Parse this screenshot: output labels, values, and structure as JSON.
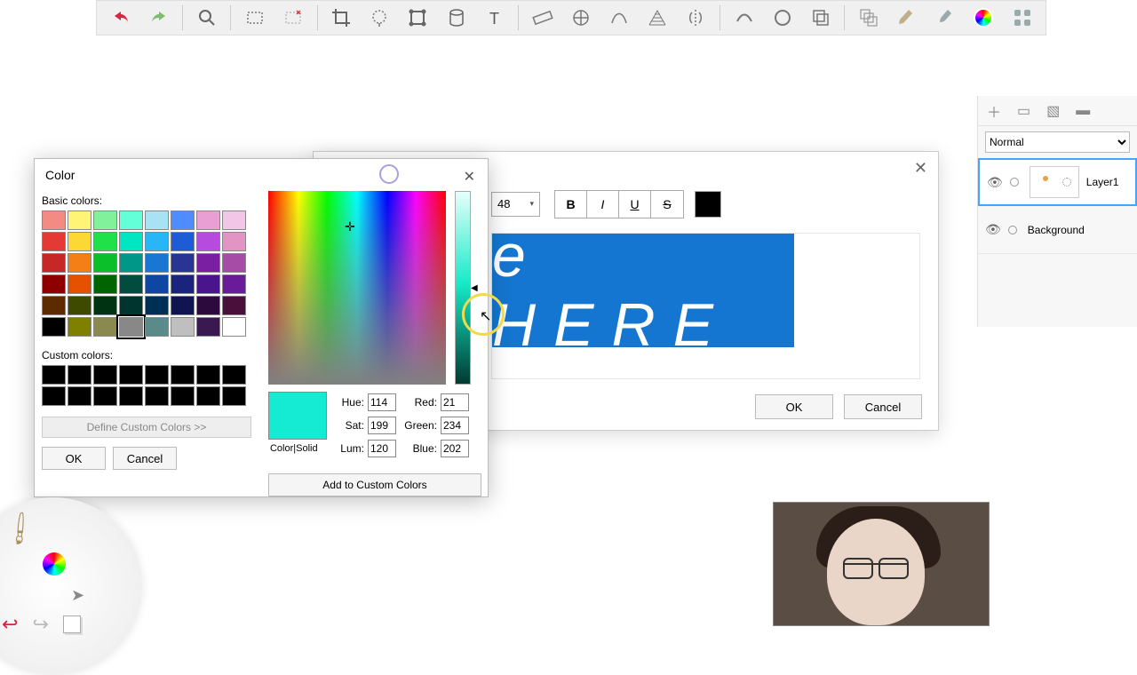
{
  "toolbar_icons": [
    "undo",
    "redo",
    "zoom",
    "select-rect",
    "select-remove",
    "crop",
    "select-free",
    "shape",
    "cylinder",
    "text",
    "ruler",
    "circle-tool",
    "paint",
    "mesh",
    "mirror",
    "curve",
    "ellipse",
    "stack",
    "copies",
    "pencil",
    "brush",
    "color-wheel",
    "grid-icons"
  ],
  "text_dialog": {
    "font_size": "48",
    "bold": "B",
    "italic": "I",
    "underline": "U",
    "strike": "S",
    "banner_text": "e  HERE",
    "ok": "OK",
    "cancel": "Cancel"
  },
  "color_dialog": {
    "title": "Color",
    "basic_label": "Basic colors:",
    "custom_label": "Custom colors:",
    "define": "Define Custom Colors >>",
    "ok": "OK",
    "cancel": "Cancel",
    "preview_label": "Color|Solid",
    "hue_label": "Hue:",
    "sat_label": "Sat:",
    "lum_label": "Lum:",
    "red_label": "Red:",
    "green_label": "Green:",
    "blue_label": "Blue:",
    "hue": "114",
    "sat": "199",
    "lum": "120",
    "red": "21",
    "green": "234",
    "blue": "202",
    "add_custom": "Add to Custom Colors",
    "basic_colors": [
      "#f28b82",
      "#fff475",
      "#81f29b",
      "#62ffd9",
      "#a7e3f2",
      "#4e8cff",
      "#e99fd4",
      "#f2c6e6",
      "#e53935",
      "#fdd835",
      "#1fe24a",
      "#00e6c3",
      "#29b6f6",
      "#1e5bd6",
      "#b74be0",
      "#e295c4",
      "#c62828",
      "#f57f17",
      "#0bbf2a",
      "#009688",
      "#1976d2",
      "#283593",
      "#7b1fa2",
      "#a64ca6",
      "#8e0000",
      "#e65100",
      "#006400",
      "#004d40",
      "#0d47a1",
      "#1a237e",
      "#4a148c",
      "#6a1b9a",
      "#5d2b00",
      "#3e4a00",
      "#003311",
      "#00352f",
      "#002f55",
      "#0e1550",
      "#2c0a3d",
      "#4a0f3a",
      "#000000",
      "#808000",
      "#8a8a50",
      "#888888",
      "#5a8a8a",
      "#bfbfbf",
      "#3a1850",
      "#ffffff"
    ],
    "selected_basic_index": 43
  },
  "layers": {
    "blend_mode": "Normal",
    "layer1": "Layer1",
    "background": "Background"
  }
}
